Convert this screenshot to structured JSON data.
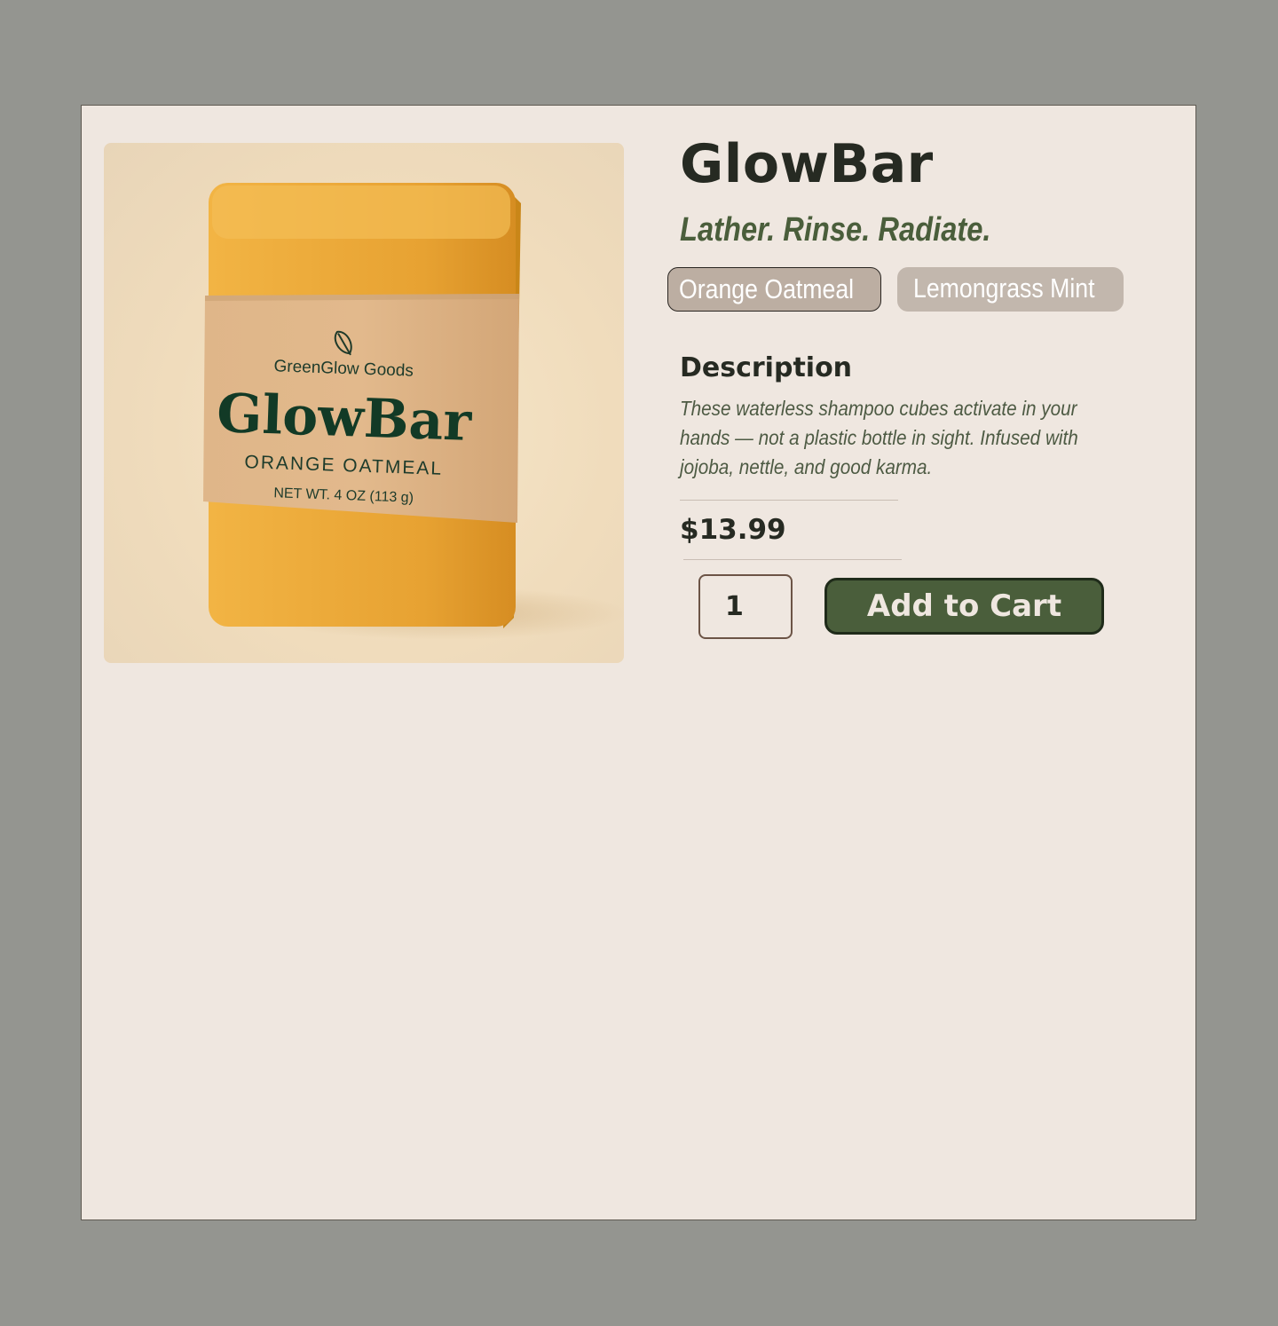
{
  "product": {
    "title": "GlowBar",
    "tagline": "Lather. Rinse. Radiate.",
    "image": {
      "brand": "GreenGlow Goods",
      "name": "GlowBar",
      "scent": "ORANGE OATMEAL",
      "weight": "NET WT. 4 OZ (113 g)"
    },
    "variants": [
      {
        "label": "Orange Oatmeal",
        "selected": true
      },
      {
        "label": "Lemongrass Mint",
        "selected": false
      }
    ],
    "description_heading": "Description",
    "description": "These waterless shampoo cubes activate in your hands — not a plastic bottle in sight. Infused with jojoba, nettle, and good karma.",
    "price": "$13.99",
    "quantity": "1",
    "add_to_cart_label": "Add to Cart"
  },
  "colors": {
    "background": "#949590",
    "card": "#efe7e0",
    "accent_green": "#4a5e3b",
    "variant_chip": "#c2b7ad",
    "heading_text": "#262a22"
  },
  "icons": {
    "brand_logo": "leaf-icon"
  }
}
